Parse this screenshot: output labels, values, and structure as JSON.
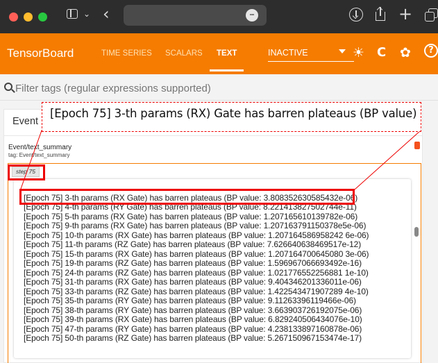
{
  "browser": {
    "sidebar_chevron": "⌄",
    "back_glyph": "‹",
    "more_glyph": "•••",
    "download_glyph": "⊕",
    "share_glyph": "⇧",
    "newtab_glyph": "+",
    "tabs_glyph": "⧉"
  },
  "app": {
    "brand": "TensorBoard",
    "nav": [
      "TIME SERIES",
      "SCALARS",
      "TEXT"
    ],
    "active_tab": "TEXT",
    "run_selector": "INACTIVE",
    "accent_color": "#f57c00"
  },
  "filter": {
    "placeholder": "Filter tags (regular expressions supported)"
  },
  "card": {
    "title": "Event",
    "collapse_glyph": "^",
    "run": "Event/text_summary",
    "tag": "tag: Event/text_summary",
    "step": "step 75"
  },
  "callout": "[Epoch 75] 3-th params (RX) Gate has barren plateaus (BP value)",
  "lines": [
    "[Epoch 75] 3-th params (RX Gate) has barren plateaus (BP value: 3.808352630585432e-06)",
    "[Epoch 75] 4-th params (RY Gate) has barren plateaus (BP value: 8.221413827502744e-11)",
    "[Epoch 75] 5-th params (RX Gate) has barren plateaus (BP value: 1.207165610139782e-06)",
    "[Epoch 75] 9-th params (RX Gate) has barren plateaus (BP value: 1.207163791150378e5e-06)",
    "[Epoch 75] 10-th params (RX Gate) has barren plateaus (BP value: 1.207164586958242 6e-06)",
    "[Epoch 75] 11-th params (RZ Gate) has barren plateaus (BP value: 7.626640638469517e-12)",
    "[Epoch 75] 15-th params (RX Gate) has barren plateaus (BP value: 1.207164700645080 3e-06)",
    "[Epoch 75] 19-th params (RZ Gate) has barren plateaus (BP value: 1.596967066693492e-16)",
    "[Epoch 75] 24-th params (RZ Gate) has barren plateaus (BP value: 1.021776552256881 1e-10)",
    "[Epoch 75] 31-th params (RX Gate) has barren plateaus (BP value: 9.404346201336011e-06)",
    "[Epoch 75] 33-th params (RZ Gate) has barren plateaus (BP value: 1.422543471907289 4e-10)",
    "[Epoch 75] 35-th params (RY Gate) has barren plateaus (BP value: 9.11263396119466e-06)",
    "[Epoch 75] 38-th params (RY Gate) has barren plateaus (BP value: 3.663903726192075e-06)",
    "[Epoch 75] 39-th params (RX Gate) has barren plateaus (BP value: 6.829240506434076e-10)",
    "[Epoch 75] 47-th params (RY Gate) has barren plateaus (BP value: 4.238133897160878e-06)",
    "[Epoch 75] 50-th params (RZ Gate) has barren plateaus (BP value: 5.267150967153474e-17)"
  ]
}
